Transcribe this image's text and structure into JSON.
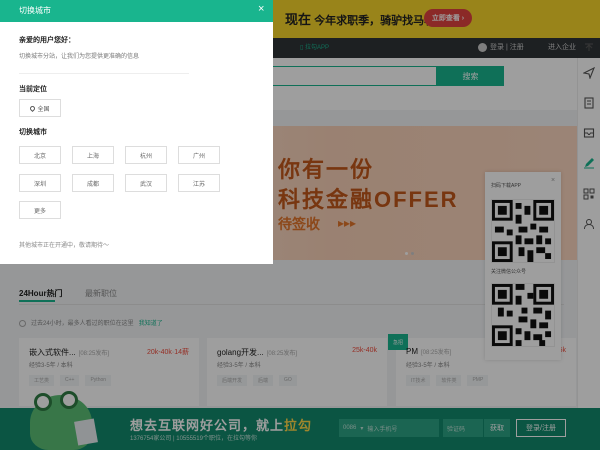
{
  "banner": {
    "lead": "现在",
    "text": "今年求职季，骑驴找马看机会",
    "cta": "立即查看 ›"
  },
  "nav": {
    "app": "拉勾APP",
    "login": "登录",
    "divider": "|",
    "register": "注册",
    "corp": "进入企业"
  },
  "search": {
    "button": "搜索"
  },
  "hero": {
    "line1": "你有一份",
    "line2": "科技金融OFFER",
    "line3": "待签收",
    "arrows": "▸▸▸"
  },
  "tabs": {
    "hot": "24Hour热门",
    "latest": "最新职位"
  },
  "notice": {
    "text": "过去24小时，最多人看过的职位在这里",
    "link": "我知道了"
  },
  "jobs": [
    {
      "title": "嵌入式软件...",
      "date": "[08:25发布]",
      "salary": "20k-40k·14薪",
      "req": "经验3-5年 / 本科",
      "tags": [
        "工艺类",
        "C++",
        "Python"
      ]
    },
    {
      "title": "golang开发...",
      "date": "[08:25发布]",
      "salary": "25k-40k",
      "req": "经验3-5年 / 本科",
      "tags": [
        "后端开发",
        "后端",
        "GO"
      ]
    },
    {
      "title": "PM",
      "date": "[08:25发布]",
      "salary": "35k",
      "req": "经验3-5年 / 本科",
      "tags": [
        "IT技术",
        "软件类",
        "PMP"
      ],
      "badge": "急招"
    }
  ],
  "qr": {
    "app_label": "扫码下载APP",
    "wechat_label": "关注微信公众号",
    "close": "×"
  },
  "bottom": {
    "title_a": "想去互联网好公司，就上",
    "title_hl": "拉勾",
    "sub": "1376754家公司 | 10555519个职位，在拉勾等你",
    "phone_prefix": "0086",
    "phone_placeholder": "输入手机号",
    "code_placeholder": "验证码",
    "get_code": "获取",
    "login": "登录/注册"
  },
  "modal": {
    "title": "切换城市",
    "close": "×",
    "greeting": "亲爱的用户您好：",
    "info": "切换城市分站，让我们为您提供更准确的信息",
    "current_label": "当前定位",
    "current_city": "全国",
    "switch_label": "切换城市",
    "cities": [
      "北京",
      "上海",
      "杭州",
      "广州",
      "深圳",
      "成都",
      "武汉",
      "江苏",
      "更多"
    ],
    "note": "其他城市正在开通中，敬请期待～"
  },
  "colors": {
    "brand": "#19b58e",
    "salary": "#f04c3d",
    "banner": "#f7d52b"
  },
  "icons": [
    "arrow-up-icon",
    "send-icon",
    "resume-icon",
    "inbox-icon",
    "edit-icon",
    "qrcode-icon",
    "user-icon"
  ]
}
